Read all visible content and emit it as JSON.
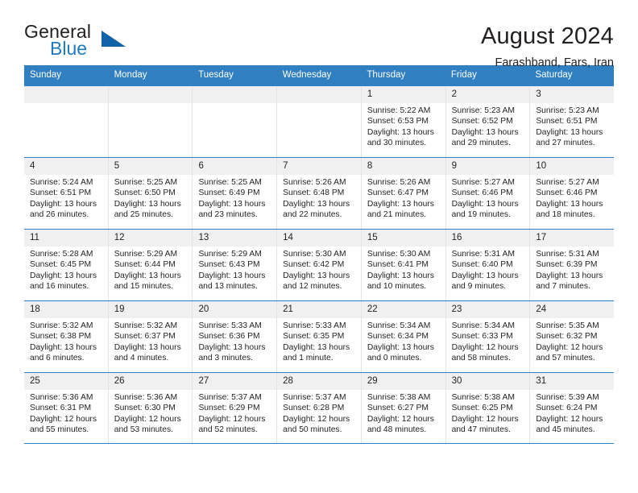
{
  "brand": {
    "name_part1": "General",
    "name_part2": "Blue",
    "triangle_color": "#1263a8",
    "blue_color": "#1f7bc1"
  },
  "header": {
    "title": "August 2024",
    "location": "Farashband, Fars, Iran",
    "header_bg": "#2f7fc1",
    "daynum_bg": "#f0f0f0"
  },
  "weekdays": [
    "Sunday",
    "Monday",
    "Tuesday",
    "Wednesday",
    "Thursday",
    "Friday",
    "Saturday"
  ],
  "weeks": [
    [
      {
        "day": "",
        "sunrise": "",
        "sunset": "",
        "daylight": "",
        "daylight2": "",
        "empty": true
      },
      {
        "day": "",
        "sunrise": "",
        "sunset": "",
        "daylight": "",
        "daylight2": "",
        "empty": true
      },
      {
        "day": "",
        "sunrise": "",
        "sunset": "",
        "daylight": "",
        "daylight2": "",
        "empty": true
      },
      {
        "day": "",
        "sunrise": "",
        "sunset": "",
        "daylight": "",
        "daylight2": "",
        "empty": true
      },
      {
        "day": "1",
        "sunrise": "Sunrise: 5:22 AM",
        "sunset": "Sunset: 6:53 PM",
        "daylight": "Daylight: 13 hours",
        "daylight2": "and 30 minutes."
      },
      {
        "day": "2",
        "sunrise": "Sunrise: 5:23 AM",
        "sunset": "Sunset: 6:52 PM",
        "daylight": "Daylight: 13 hours",
        "daylight2": "and 29 minutes."
      },
      {
        "day": "3",
        "sunrise": "Sunrise: 5:23 AM",
        "sunset": "Sunset: 6:51 PM",
        "daylight": "Daylight: 13 hours",
        "daylight2": "and 27 minutes."
      }
    ],
    [
      {
        "day": "4",
        "sunrise": "Sunrise: 5:24 AM",
        "sunset": "Sunset: 6:51 PM",
        "daylight": "Daylight: 13 hours",
        "daylight2": "and 26 minutes."
      },
      {
        "day": "5",
        "sunrise": "Sunrise: 5:25 AM",
        "sunset": "Sunset: 6:50 PM",
        "daylight": "Daylight: 13 hours",
        "daylight2": "and 25 minutes."
      },
      {
        "day": "6",
        "sunrise": "Sunrise: 5:25 AM",
        "sunset": "Sunset: 6:49 PM",
        "daylight": "Daylight: 13 hours",
        "daylight2": "and 23 minutes."
      },
      {
        "day": "7",
        "sunrise": "Sunrise: 5:26 AM",
        "sunset": "Sunset: 6:48 PM",
        "daylight": "Daylight: 13 hours",
        "daylight2": "and 22 minutes."
      },
      {
        "day": "8",
        "sunrise": "Sunrise: 5:26 AM",
        "sunset": "Sunset: 6:47 PM",
        "daylight": "Daylight: 13 hours",
        "daylight2": "and 21 minutes."
      },
      {
        "day": "9",
        "sunrise": "Sunrise: 5:27 AM",
        "sunset": "Sunset: 6:46 PM",
        "daylight": "Daylight: 13 hours",
        "daylight2": "and 19 minutes."
      },
      {
        "day": "10",
        "sunrise": "Sunrise: 5:27 AM",
        "sunset": "Sunset: 6:46 PM",
        "daylight": "Daylight: 13 hours",
        "daylight2": "and 18 minutes."
      }
    ],
    [
      {
        "day": "11",
        "sunrise": "Sunrise: 5:28 AM",
        "sunset": "Sunset: 6:45 PM",
        "daylight": "Daylight: 13 hours",
        "daylight2": "and 16 minutes."
      },
      {
        "day": "12",
        "sunrise": "Sunrise: 5:29 AM",
        "sunset": "Sunset: 6:44 PM",
        "daylight": "Daylight: 13 hours",
        "daylight2": "and 15 minutes."
      },
      {
        "day": "13",
        "sunrise": "Sunrise: 5:29 AM",
        "sunset": "Sunset: 6:43 PM",
        "daylight": "Daylight: 13 hours",
        "daylight2": "and 13 minutes."
      },
      {
        "day": "14",
        "sunrise": "Sunrise: 5:30 AM",
        "sunset": "Sunset: 6:42 PM",
        "daylight": "Daylight: 13 hours",
        "daylight2": "and 12 minutes."
      },
      {
        "day": "15",
        "sunrise": "Sunrise: 5:30 AM",
        "sunset": "Sunset: 6:41 PM",
        "daylight": "Daylight: 13 hours",
        "daylight2": "and 10 minutes."
      },
      {
        "day": "16",
        "sunrise": "Sunrise: 5:31 AM",
        "sunset": "Sunset: 6:40 PM",
        "daylight": "Daylight: 13 hours",
        "daylight2": "and 9 minutes."
      },
      {
        "day": "17",
        "sunrise": "Sunrise: 5:31 AM",
        "sunset": "Sunset: 6:39 PM",
        "daylight": "Daylight: 13 hours",
        "daylight2": "and 7 minutes."
      }
    ],
    [
      {
        "day": "18",
        "sunrise": "Sunrise: 5:32 AM",
        "sunset": "Sunset: 6:38 PM",
        "daylight": "Daylight: 13 hours",
        "daylight2": "and 6 minutes."
      },
      {
        "day": "19",
        "sunrise": "Sunrise: 5:32 AM",
        "sunset": "Sunset: 6:37 PM",
        "daylight": "Daylight: 13 hours",
        "daylight2": "and 4 minutes."
      },
      {
        "day": "20",
        "sunrise": "Sunrise: 5:33 AM",
        "sunset": "Sunset: 6:36 PM",
        "daylight": "Daylight: 13 hours",
        "daylight2": "and 3 minutes."
      },
      {
        "day": "21",
        "sunrise": "Sunrise: 5:33 AM",
        "sunset": "Sunset: 6:35 PM",
        "daylight": "Daylight: 13 hours",
        "daylight2": "and 1 minute."
      },
      {
        "day": "22",
        "sunrise": "Sunrise: 5:34 AM",
        "sunset": "Sunset: 6:34 PM",
        "daylight": "Daylight: 13 hours",
        "daylight2": "and 0 minutes."
      },
      {
        "day": "23",
        "sunrise": "Sunrise: 5:34 AM",
        "sunset": "Sunset: 6:33 PM",
        "daylight": "Daylight: 12 hours",
        "daylight2": "and 58 minutes."
      },
      {
        "day": "24",
        "sunrise": "Sunrise: 5:35 AM",
        "sunset": "Sunset: 6:32 PM",
        "daylight": "Daylight: 12 hours",
        "daylight2": "and 57 minutes."
      }
    ],
    [
      {
        "day": "25",
        "sunrise": "Sunrise: 5:36 AM",
        "sunset": "Sunset: 6:31 PM",
        "daylight": "Daylight: 12 hours",
        "daylight2": "and 55 minutes."
      },
      {
        "day": "26",
        "sunrise": "Sunrise: 5:36 AM",
        "sunset": "Sunset: 6:30 PM",
        "daylight": "Daylight: 12 hours",
        "daylight2": "and 53 minutes."
      },
      {
        "day": "27",
        "sunrise": "Sunrise: 5:37 AM",
        "sunset": "Sunset: 6:29 PM",
        "daylight": "Daylight: 12 hours",
        "daylight2": "and 52 minutes."
      },
      {
        "day": "28",
        "sunrise": "Sunrise: 5:37 AM",
        "sunset": "Sunset: 6:28 PM",
        "daylight": "Daylight: 12 hours",
        "daylight2": "and 50 minutes."
      },
      {
        "day": "29",
        "sunrise": "Sunrise: 5:38 AM",
        "sunset": "Sunset: 6:27 PM",
        "daylight": "Daylight: 12 hours",
        "daylight2": "and 48 minutes."
      },
      {
        "day": "30",
        "sunrise": "Sunrise: 5:38 AM",
        "sunset": "Sunset: 6:25 PM",
        "daylight": "Daylight: 12 hours",
        "daylight2": "and 47 minutes."
      },
      {
        "day": "31",
        "sunrise": "Sunrise: 5:39 AM",
        "sunset": "Sunset: 6:24 PM",
        "daylight": "Daylight: 12 hours",
        "daylight2": "and 45 minutes."
      }
    ]
  ]
}
